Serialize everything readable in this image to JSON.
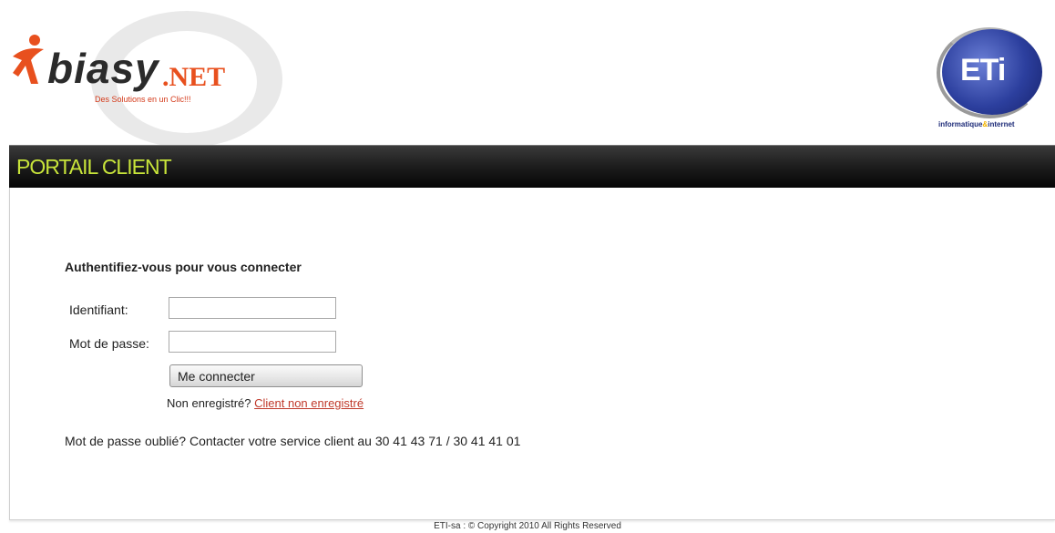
{
  "header": {
    "brand_left": {
      "word": "biasy",
      "suffix": ".NET",
      "tagline": "Des Solutions en un Clic!!!"
    },
    "brand_right": {
      "word": "ETi",
      "caption_prefix": "informatique",
      "caption_amp": "&",
      "caption_suffix": "internet"
    }
  },
  "portal": {
    "title": "PORTAIL CLIENT"
  },
  "login": {
    "heading": "Authentifiez-vous pour vous connecter",
    "username_label": "Identifiant:",
    "username_value": "",
    "password_label": "Mot de passe:",
    "password_value": "",
    "submit_label": "Me connecter",
    "not_registered_text": "Non enregistré?",
    "not_registered_link": "Client non enregistré",
    "forgot_text": "Mot de passe oublié? Contacter votre service client au 30 41 43 71 / 30 41 41 01"
  },
  "footer": {
    "copyright": "ETI-sa : © Copyright 2010 All Rights Reserved"
  },
  "colors": {
    "portal_title": "#c8e43a",
    "link": "#c0392b",
    "band": "#1c1c1c"
  },
  "icons": [
    "person-figure-icon",
    "at-sign-watermark-icon",
    "eti-globe-logo-icon"
  ]
}
